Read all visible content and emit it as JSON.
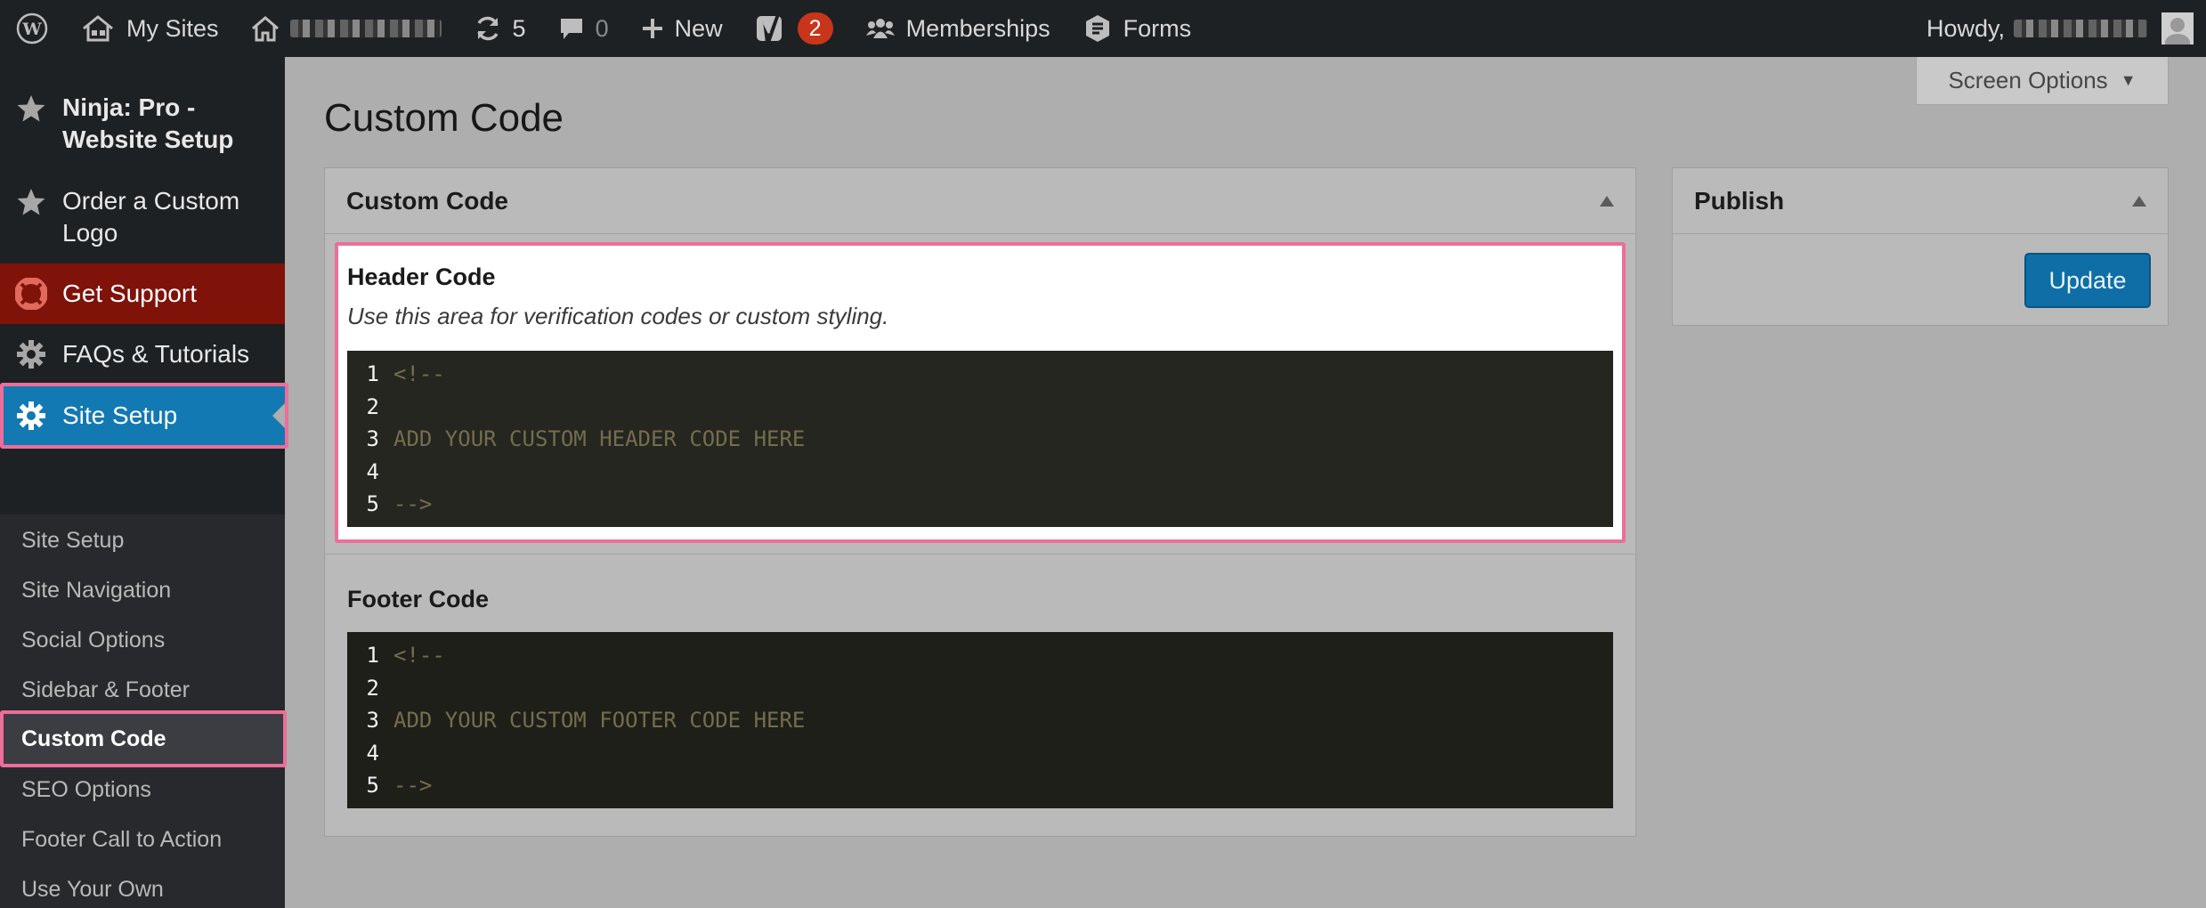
{
  "adminbar": {
    "my_sites": "My Sites",
    "updates_count": "5",
    "comments_count": "0",
    "new_label": "New",
    "yoast_badge": "2",
    "memberships": "Memberships",
    "forms": "Forms",
    "howdy": "Howdy,"
  },
  "sidebar": {
    "items": [
      {
        "label": "Ninja: Pro - Website Setup",
        "icon": "star-icon"
      },
      {
        "label": "Order a Custom Logo",
        "icon": "star-icon"
      },
      {
        "label": "Get Support",
        "icon": "lifebuoy-icon"
      },
      {
        "label": "FAQs & Tutorials",
        "icon": "gear-icon"
      },
      {
        "label": "Site Setup",
        "icon": "gear-icon"
      }
    ],
    "submenu": [
      "Site Setup",
      "Site Navigation",
      "Social Options",
      "Sidebar & Footer",
      "Custom Code",
      "SEO Options",
      "Footer Call to Action",
      "Use Your Own Domain"
    ]
  },
  "main": {
    "screen_options": "Screen Options",
    "title": "Custom Code",
    "custom_code_box": {
      "title": "Custom Code",
      "header_title": "Header Code",
      "header_desc": "Use this area for verification codes or custom styling.",
      "header_lines": [
        "<!--",
        "",
        "ADD YOUR CUSTOM HEADER CODE HERE",
        "",
        "-->"
      ],
      "footer_title": "Footer Code",
      "footer_lines": [
        "<!--",
        "",
        "ADD YOUR CUSTOM FOOTER CODE HERE",
        "",
        "-->"
      ]
    },
    "publish_box": {
      "title": "Publish",
      "update_label": "Update"
    }
  },
  "colors": {
    "accent": "#1379b2",
    "support": "#7f1309",
    "highlight": "#ec6e99",
    "badge": "#c9351b"
  }
}
